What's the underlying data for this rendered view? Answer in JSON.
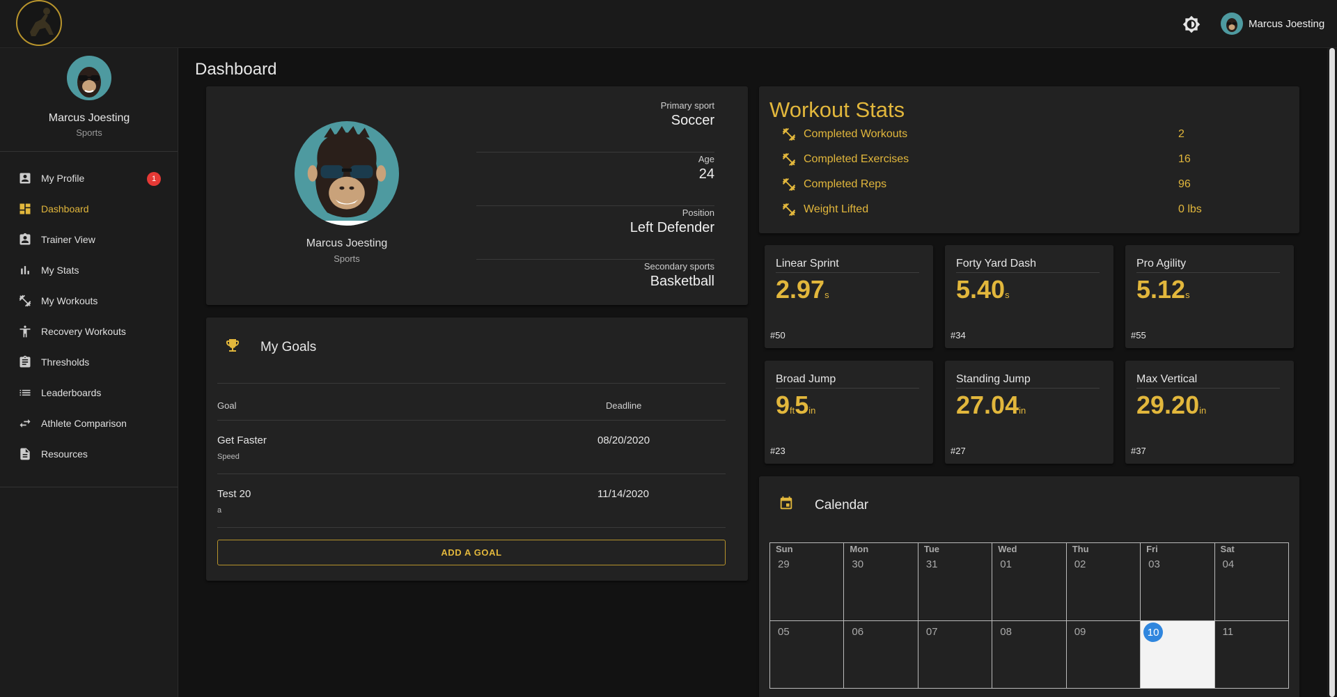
{
  "header": {
    "user_name": "Marcus Joesting"
  },
  "sidebar": {
    "name": "Marcus Joesting",
    "role": "Sports",
    "items": [
      {
        "label": "My Profile",
        "icon": "account-box-icon",
        "badge": "1"
      },
      {
        "label": "Dashboard",
        "icon": "dashboard-icon",
        "active": true
      },
      {
        "label": "Trainer View",
        "icon": "badge-icon"
      },
      {
        "label": "My Stats",
        "icon": "bar-chart-icon"
      },
      {
        "label": "My Workouts",
        "icon": "dumbbell-icon"
      },
      {
        "label": "Recovery Workouts",
        "icon": "accessibility-icon"
      },
      {
        "label": "Thresholds",
        "icon": "clipboard-icon"
      },
      {
        "label": "Leaderboards",
        "icon": "list-icon"
      },
      {
        "label": "Athlete Comparison",
        "icon": "swap-icon"
      },
      {
        "label": "Resources",
        "icon": "document-icon"
      }
    ]
  },
  "page": {
    "title": "Dashboard"
  },
  "profile": {
    "name": "Marcus Joesting",
    "role": "Sports",
    "fields": [
      {
        "label": "Primary sport",
        "value": "Soccer"
      },
      {
        "label": "Age",
        "value": "24"
      },
      {
        "label": "Position",
        "value": "Left Defender"
      },
      {
        "label": "Secondary sports",
        "value": "Basketball"
      }
    ]
  },
  "goals": {
    "title": "My Goals",
    "col_goal": "Goal",
    "col_deadline": "Deadline",
    "rows": [
      {
        "goal": "Get Faster",
        "sub": "Speed",
        "deadline": "08/20/2020"
      },
      {
        "goal": "Test 20",
        "sub": "a",
        "deadline": "11/14/2020"
      }
    ],
    "add_label": "ADD A GOAL"
  },
  "workout_stats": {
    "title": "Workout Stats",
    "rows": [
      {
        "label": "Completed Workouts",
        "value": "2"
      },
      {
        "label": "Completed Exercises",
        "value": "16"
      },
      {
        "label": "Completed Reps",
        "value": "96"
      },
      {
        "label": "Weight Lifted",
        "value": "0 lbs"
      }
    ]
  },
  "metrics": [
    {
      "title": "Linear Sprint",
      "value": "2.97",
      "unit": "s",
      "rank": "#50"
    },
    {
      "title": "Forty Yard Dash",
      "value": "5.40",
      "unit": "s",
      "rank": "#34"
    },
    {
      "title": "Pro Agility",
      "value": "5.12",
      "unit": "s",
      "rank": "#55"
    },
    {
      "title": "Broad Jump",
      "value_ft": "9",
      "unit_ft": "ft",
      "value_in": "5",
      "unit_in": "in",
      "rank": "#23"
    },
    {
      "title": "Standing Jump",
      "value": "27.04",
      "unit": "in",
      "rank": "#27"
    },
    {
      "title": "Max Vertical",
      "value": "29.20",
      "unit": "in",
      "rank": "#37"
    }
  ],
  "calendar": {
    "title": "Calendar",
    "weekdays": [
      "Sun",
      "Mon",
      "Tue",
      "Wed",
      "Thu",
      "Fri",
      "Sat"
    ],
    "week1": [
      "29",
      "30",
      "31",
      "01",
      "02",
      "03",
      "04"
    ],
    "week2": [
      "05",
      "06",
      "07",
      "08",
      "09",
      "10",
      "11"
    ],
    "today": "10"
  },
  "colors": {
    "accent": "#e2b73c",
    "today": "#2f86de",
    "badge": "#e53935"
  }
}
